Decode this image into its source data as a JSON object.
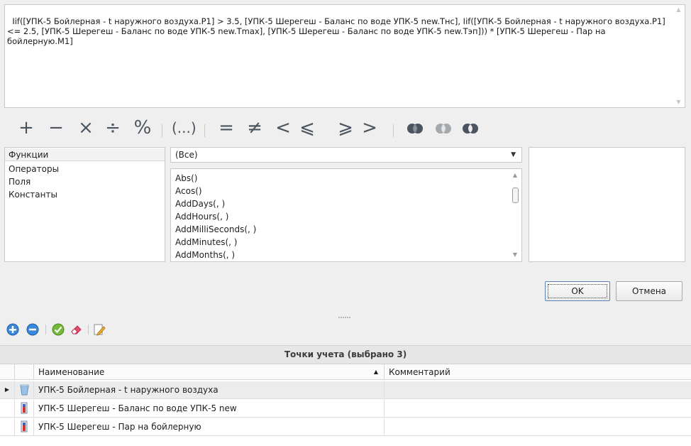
{
  "expression": {
    "text": "Iif([УПК-5 Бойлерная - t наружного воздуха.P1] > 3.5, [УПК-5 Шерегеш - Баланс по воде УПК-5 new.Tнс], Iif([УПК-5 Бойлерная - t наружного воздуха.P1] <= 2.5, [УПК-5 Шерегеш - Баланс по воде УПК-5 new.Tmax], [УПК-5 Шерегеш - Баланс по воде УПК-5 new.Tэп])) * [УПК-5 Шерегеш - Пар на бойлерную.M1]"
  },
  "operators": {
    "arithmetic": [
      "+",
      "−",
      "×",
      "÷",
      "%"
    ],
    "parens": "(...)",
    "comparison": [
      "=",
      "≠",
      "<",
      "⩽",
      "⩾",
      ">"
    ],
    "logical_icons": [
      "logical-and-icon",
      "logical-or-icon",
      "logical-not-icon"
    ]
  },
  "categories": [
    "Функции",
    "Операторы",
    "Поля",
    "Константы"
  ],
  "filter": {
    "selected": "(Все)"
  },
  "functions": [
    "Abs()",
    "Acos()",
    "AddDays(, )",
    "AddHours(, )",
    "AddMilliSeconds(, )",
    "AddMinutes(, )",
    "AddMonths(, )"
  ],
  "buttons": {
    "ok": "OK",
    "cancel": "Отмена"
  },
  "toolbar": {
    "icons": [
      "add-icon",
      "remove-icon",
      "check-icon",
      "eraser-icon",
      "edit-icon"
    ]
  },
  "grid": {
    "title": "Точки учета (выбрано 3)",
    "columns": [
      "Наименование",
      "Комментарий"
    ],
    "rows": [
      {
        "name": "УПК-5 Бойлерная - t наружного воздуха",
        "comment": "",
        "icon": "bucket-icon"
      },
      {
        "name": "УПК-5 Шерегеш - Баланс по воде УПК-5 new",
        "comment": "",
        "icon": "thermometer-icon"
      },
      {
        "name": "УПК-5 Шерегеш - Пар на бойлерную",
        "comment": "",
        "icon": "thermometer-icon"
      }
    ]
  },
  "colors": {
    "accent": "#2a7fd8",
    "ok_border": "#5e83b8",
    "icon_gray": "#4a5560"
  }
}
